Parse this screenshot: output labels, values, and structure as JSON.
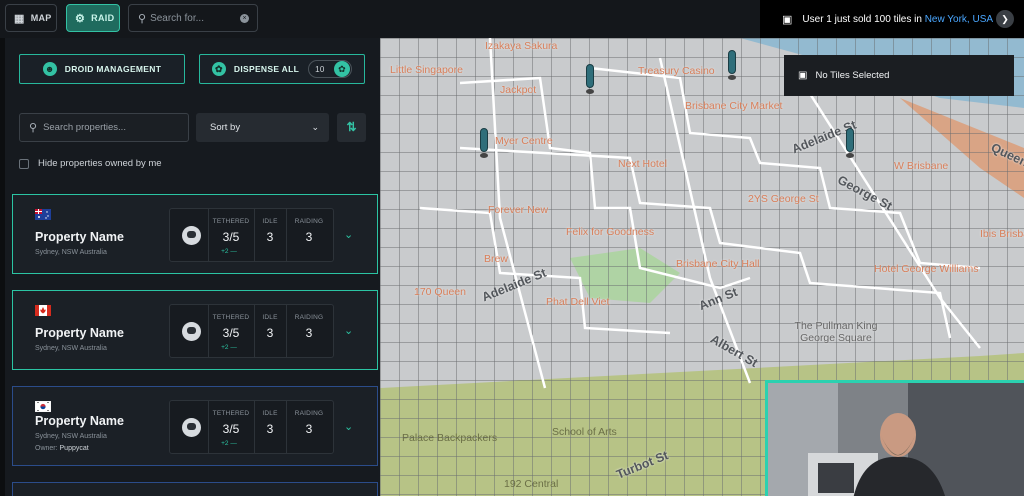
{
  "topbar": {
    "map_label": "MAP",
    "raid_label": "RAID",
    "search_placeholder": "Search for...",
    "map_icon": "map-icon",
    "raid_icon": "raid-icon",
    "search_icon": "search-icon",
    "clear_icon": "clear-icon"
  },
  "notification": {
    "text": "User 1 just sold 100 tiles in ",
    "location": "New York, USA",
    "icon": "store-icon",
    "arrow_icon": "chevron-right-icon"
  },
  "panel": {
    "droid_management_label": "DROID MANAGEMENT",
    "dispense_all_label": "DISPENSE ALL",
    "dispense_count": "10",
    "search_placeholder": "Search properties...",
    "sort_label": "Sort by",
    "hide_owned_label": "Hide properties owned by me"
  },
  "stat_labels": {
    "tethered": "TETHERED",
    "idle": "IDLE",
    "raiding": "RAIDING"
  },
  "properties": [
    {
      "name": "Property Name",
      "location": "Sydney, NSW Australia",
      "flag": "australia-flag",
      "tethered": "3/5",
      "tethered_delta": "+2",
      "idle": "3",
      "raiding": "3"
    },
    {
      "name": "Property Name",
      "location": "Sydney, NSW Australia",
      "flag": "canada-flag",
      "tethered": "3/5",
      "tethered_delta": "+2",
      "idle": "3",
      "raiding": "3"
    },
    {
      "name": "Property Name",
      "location": "Sydney, NSW Australia",
      "owner_label": "Owner:",
      "owner": "Puppycat",
      "flag": "south-korea-flag",
      "tethered": "3/5",
      "tethered_delta": "+2",
      "idle": "3",
      "raiding": "3"
    }
  ],
  "map": {
    "selection_status": "No Tiles Selected",
    "places": [
      "Izakaya Sakura",
      "Little Singapore",
      "Jackpot",
      "Treasury Casino",
      "Myer Centre",
      "Brisbane City Market",
      "Next Hotel",
      "Forever New",
      "Felix for Goodness",
      "2YS George St",
      "Brisbane City Hall",
      "W Brisbane",
      "Brew",
      "Hotel George Williams",
      "170 Queen",
      "Phat Dell Viet",
      "The Pullman King George Square",
      "Ibis Brisbane",
      "Palace Backpackers",
      "School of Arts",
      "192 Central"
    ],
    "streets": [
      "Adelaide St",
      "Ann St",
      "Albert St",
      "George St",
      "Adelaide St",
      "Turbot St",
      "Queen"
    ]
  },
  "colors": {
    "accent": "#2bc4a3",
    "raid_bg": "#1f6b5e",
    "link": "#4aa7ff",
    "card_alt_border": "#2b4c8a"
  }
}
